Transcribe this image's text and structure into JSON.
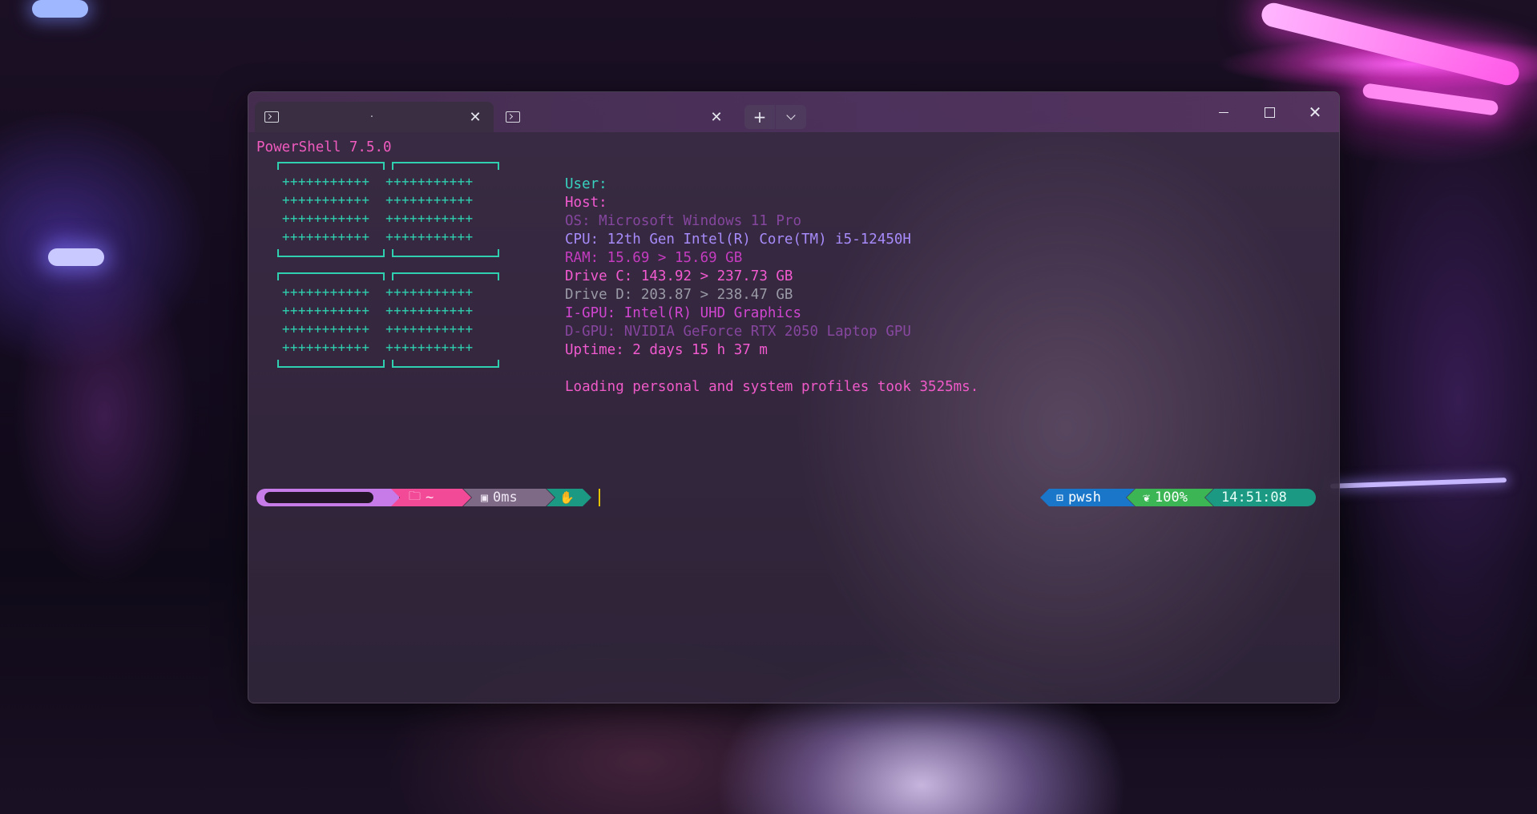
{
  "window": {
    "tabs": [
      {
        "title": "·"
      },
      {
        "title": ""
      }
    ],
    "new_tab_label": "+",
    "tab_menu_label": "⌄"
  },
  "terminal": {
    "ps_version": "PowerShell 7.5.0",
    "art_row": "+++++++++++  +++++++++++",
    "info": {
      "user": "User:",
      "host": "Host:",
      "os": "OS: Microsoft Windows 11 Pro",
      "cpu": "CPU: 12th Gen Intel(R) Core(TM) i5-12450H",
      "ram": "RAM: 15.69 > 15.69 GB",
      "drive_c": "Drive C: 143.92 > 237.73 GB",
      "drive_d": "Drive D: 203.87 > 238.47 GB",
      "igpu": "I-GPU: Intel(R) UHD Graphics",
      "dgpu": "D-GPU: NVIDIA GeForce RTX 2050 Laptop GPU",
      "uptime": "Uptime: 2 days 15 h 37 m"
    },
    "load_message": "Loading personal and system profiles took 3525ms."
  },
  "prompt": {
    "path": "~",
    "exec_time": "0ms",
    "shell": "pwsh",
    "battery": "100%",
    "clock": "14:51:08"
  },
  "colors": {
    "accent_pink": "#f24a97",
    "teal": "#2fd0b0",
    "violet": "#a78bfa",
    "pwsh_blue": "#1976c8",
    "battery_green": "#3cb554"
  }
}
